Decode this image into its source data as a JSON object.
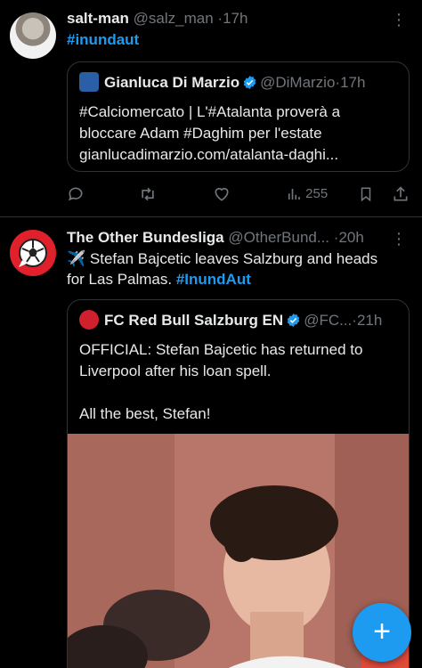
{
  "tweet1": {
    "name": "salt-man",
    "handle": "@salz_man",
    "sep": "·",
    "time": "17h",
    "hashtag": "#inundaut",
    "quote": {
      "name": "Gianluca Di Marzio",
      "handle": "@DiMarzio",
      "sep": "·",
      "time": "17h",
      "line1": "#Calciomercato | L'#Atalanta proverà a",
      "line2": "bloccare Adam #Daghim per l'estate",
      "line3": "gianlucadimarzio.com/atalanta-daghi..."
    },
    "views": "255"
  },
  "tweet2": {
    "name": "The Other Bundesliga",
    "handle": "@OtherBund...",
    "sep": "·",
    "time": "20h",
    "line1": "✈️ Stefan Bajcetic leaves Salzburg and heads",
    "line2_text": "for Las Palmas. ",
    "line2_hashtag": "#InundAut",
    "quote": {
      "name": "FC Red Bull Salzburg EN",
      "handle": "@FC...",
      "sep": "·",
      "time": "21h",
      "line1": "OFFICIAL: Stefan Bajcetic has returned to",
      "line2": "Liverpool after his loan spell.",
      "line3": "All the best, Stefan!"
    }
  },
  "fab": {
    "label": "+"
  },
  "colors": {
    "accent": "#1d9bf0",
    "muted": "#71767b",
    "background": "#000000"
  }
}
